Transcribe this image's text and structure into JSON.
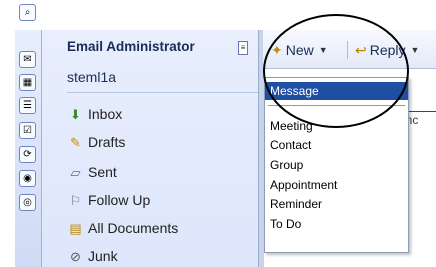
{
  "account": {
    "name": "Email Administrator",
    "username": "steml1a"
  },
  "folders": [
    {
      "label": "Inbox",
      "icon": "inbox-icon"
    },
    {
      "label": "Drafts",
      "icon": "drafts-icon"
    },
    {
      "label": "Sent",
      "icon": "sent-icon"
    },
    {
      "label": "Follow Up",
      "icon": "flag-icon"
    },
    {
      "label": "All Documents",
      "icon": "all-documents-icon"
    },
    {
      "label": "Junk",
      "icon": "junk-icon"
    }
  ],
  "rail_icons": [
    "binoculars-icon",
    "mail-icon",
    "calendar-icon",
    "contacts-icon",
    "todo-icon",
    "replication-icon",
    "feeds-icon",
    "more-icon"
  ],
  "toolbar": {
    "new_label": "New",
    "reply_label": "Reply"
  },
  "new_menu": {
    "items": [
      "Message",
      "Meeting",
      "Contact",
      "Group",
      "Appointment",
      "Reminder",
      "To Do"
    ],
    "selected": "Message"
  },
  "content_peek": "Princ",
  "colors": {
    "menu_highlight": "#1f4fa3",
    "pane_bg": "#e3eafc"
  }
}
